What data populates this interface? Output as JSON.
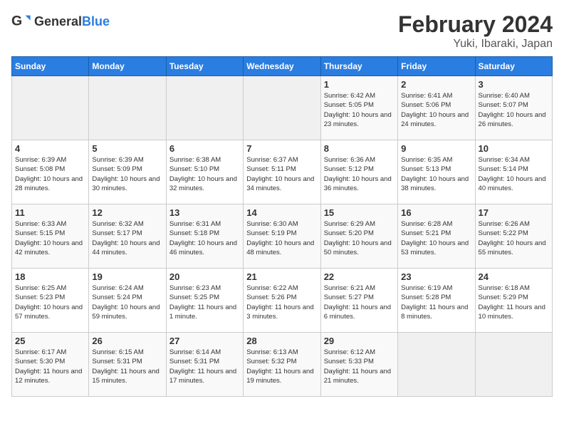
{
  "header": {
    "logo_general": "General",
    "logo_blue": "Blue",
    "title": "February 2024",
    "subtitle": "Yuki, Ibaraki, Japan"
  },
  "weekdays": [
    "Sunday",
    "Monday",
    "Tuesday",
    "Wednesday",
    "Thursday",
    "Friday",
    "Saturday"
  ],
  "weeks": [
    [
      {
        "day": "",
        "empty": true
      },
      {
        "day": "",
        "empty": true
      },
      {
        "day": "",
        "empty": true
      },
      {
        "day": "",
        "empty": true
      },
      {
        "day": "1",
        "sunrise": "Sunrise: 6:42 AM",
        "sunset": "Sunset: 5:05 PM",
        "daylight": "Daylight: 10 hours and 23 minutes."
      },
      {
        "day": "2",
        "sunrise": "Sunrise: 6:41 AM",
        "sunset": "Sunset: 5:06 PM",
        "daylight": "Daylight: 10 hours and 24 minutes."
      },
      {
        "day": "3",
        "sunrise": "Sunrise: 6:40 AM",
        "sunset": "Sunset: 5:07 PM",
        "daylight": "Daylight: 10 hours and 26 minutes."
      }
    ],
    [
      {
        "day": "4",
        "sunrise": "Sunrise: 6:39 AM",
        "sunset": "Sunset: 5:08 PM",
        "daylight": "Daylight: 10 hours and 28 minutes."
      },
      {
        "day": "5",
        "sunrise": "Sunrise: 6:39 AM",
        "sunset": "Sunset: 5:09 PM",
        "daylight": "Daylight: 10 hours and 30 minutes."
      },
      {
        "day": "6",
        "sunrise": "Sunrise: 6:38 AM",
        "sunset": "Sunset: 5:10 PM",
        "daylight": "Daylight: 10 hours and 32 minutes."
      },
      {
        "day": "7",
        "sunrise": "Sunrise: 6:37 AM",
        "sunset": "Sunset: 5:11 PM",
        "daylight": "Daylight: 10 hours and 34 minutes."
      },
      {
        "day": "8",
        "sunrise": "Sunrise: 6:36 AM",
        "sunset": "Sunset: 5:12 PM",
        "daylight": "Daylight: 10 hours and 36 minutes."
      },
      {
        "day": "9",
        "sunrise": "Sunrise: 6:35 AM",
        "sunset": "Sunset: 5:13 PM",
        "daylight": "Daylight: 10 hours and 38 minutes."
      },
      {
        "day": "10",
        "sunrise": "Sunrise: 6:34 AM",
        "sunset": "Sunset: 5:14 PM",
        "daylight": "Daylight: 10 hours and 40 minutes."
      }
    ],
    [
      {
        "day": "11",
        "sunrise": "Sunrise: 6:33 AM",
        "sunset": "Sunset: 5:15 PM",
        "daylight": "Daylight: 10 hours and 42 minutes."
      },
      {
        "day": "12",
        "sunrise": "Sunrise: 6:32 AM",
        "sunset": "Sunset: 5:17 PM",
        "daylight": "Daylight: 10 hours and 44 minutes."
      },
      {
        "day": "13",
        "sunrise": "Sunrise: 6:31 AM",
        "sunset": "Sunset: 5:18 PM",
        "daylight": "Daylight: 10 hours and 46 minutes."
      },
      {
        "day": "14",
        "sunrise": "Sunrise: 6:30 AM",
        "sunset": "Sunset: 5:19 PM",
        "daylight": "Daylight: 10 hours and 48 minutes."
      },
      {
        "day": "15",
        "sunrise": "Sunrise: 6:29 AM",
        "sunset": "Sunset: 5:20 PM",
        "daylight": "Daylight: 10 hours and 50 minutes."
      },
      {
        "day": "16",
        "sunrise": "Sunrise: 6:28 AM",
        "sunset": "Sunset: 5:21 PM",
        "daylight": "Daylight: 10 hours and 53 minutes."
      },
      {
        "day": "17",
        "sunrise": "Sunrise: 6:26 AM",
        "sunset": "Sunset: 5:22 PM",
        "daylight": "Daylight: 10 hours and 55 minutes."
      }
    ],
    [
      {
        "day": "18",
        "sunrise": "Sunrise: 6:25 AM",
        "sunset": "Sunset: 5:23 PM",
        "daylight": "Daylight: 10 hours and 57 minutes."
      },
      {
        "day": "19",
        "sunrise": "Sunrise: 6:24 AM",
        "sunset": "Sunset: 5:24 PM",
        "daylight": "Daylight: 10 hours and 59 minutes."
      },
      {
        "day": "20",
        "sunrise": "Sunrise: 6:23 AM",
        "sunset": "Sunset: 5:25 PM",
        "daylight": "Daylight: 11 hours and 1 minute."
      },
      {
        "day": "21",
        "sunrise": "Sunrise: 6:22 AM",
        "sunset": "Sunset: 5:26 PM",
        "daylight": "Daylight: 11 hours and 3 minutes."
      },
      {
        "day": "22",
        "sunrise": "Sunrise: 6:21 AM",
        "sunset": "Sunset: 5:27 PM",
        "daylight": "Daylight: 11 hours and 6 minutes."
      },
      {
        "day": "23",
        "sunrise": "Sunrise: 6:19 AM",
        "sunset": "Sunset: 5:28 PM",
        "daylight": "Daylight: 11 hours and 8 minutes."
      },
      {
        "day": "24",
        "sunrise": "Sunrise: 6:18 AM",
        "sunset": "Sunset: 5:29 PM",
        "daylight": "Daylight: 11 hours and 10 minutes."
      }
    ],
    [
      {
        "day": "25",
        "sunrise": "Sunrise: 6:17 AM",
        "sunset": "Sunset: 5:30 PM",
        "daylight": "Daylight: 11 hours and 12 minutes."
      },
      {
        "day": "26",
        "sunrise": "Sunrise: 6:15 AM",
        "sunset": "Sunset: 5:31 PM",
        "daylight": "Daylight: 11 hours and 15 minutes."
      },
      {
        "day": "27",
        "sunrise": "Sunrise: 6:14 AM",
        "sunset": "Sunset: 5:31 PM",
        "daylight": "Daylight: 11 hours and 17 minutes."
      },
      {
        "day": "28",
        "sunrise": "Sunrise: 6:13 AM",
        "sunset": "Sunset: 5:32 PM",
        "daylight": "Daylight: 11 hours and 19 minutes."
      },
      {
        "day": "29",
        "sunrise": "Sunrise: 6:12 AM",
        "sunset": "Sunset: 5:33 PM",
        "daylight": "Daylight: 11 hours and 21 minutes."
      },
      {
        "day": "",
        "empty": true
      },
      {
        "day": "",
        "empty": true
      }
    ]
  ]
}
